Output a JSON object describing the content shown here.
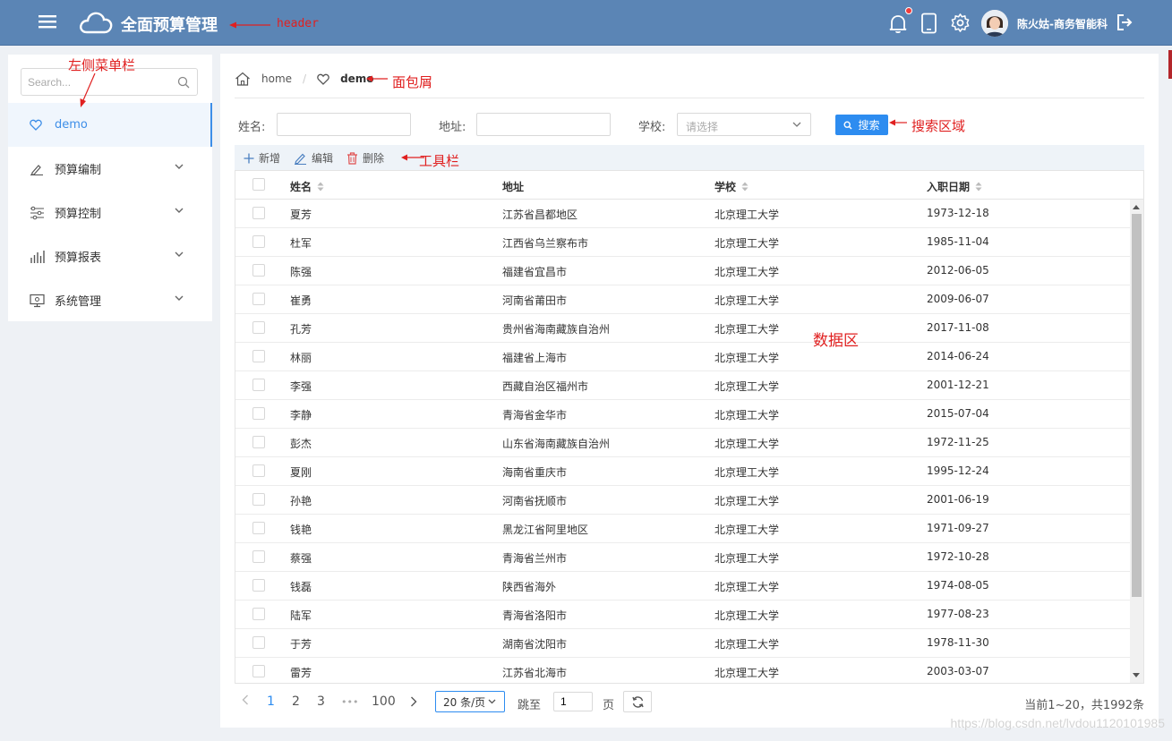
{
  "header": {
    "title": "全面预算管理",
    "user_name": "陈火姑-商务智能科",
    "icons": [
      "menu-icon",
      "cloud-icon",
      "bell-icon",
      "tablet-icon",
      "gear-icon",
      "logout-icon"
    ],
    "has_notification_dot": true
  },
  "annotations": {
    "header": "header",
    "sidebar": "左侧菜单栏",
    "breadcrumb": "面包屑",
    "search_area": "搜索区域",
    "toolbar": "工具栏",
    "data_area": "数据区"
  },
  "sidebar": {
    "search_placeholder": "Search...",
    "items": [
      {
        "label": "demo",
        "icon": "heart-icon",
        "active": true
      },
      {
        "label": "预算编制",
        "icon": "edit-icon"
      },
      {
        "label": "预算控制",
        "icon": "sliders-icon"
      },
      {
        "label": "预算报表",
        "icon": "bar-chart-icon"
      },
      {
        "label": "系统管理",
        "icon": "monitor-icon"
      }
    ]
  },
  "breadcrumb": {
    "home": "home",
    "current": "demo"
  },
  "search_form": {
    "name_label": "姓名:",
    "name_value": "",
    "address_label": "地址:",
    "address_value": "",
    "school_label": "学校:",
    "school_placeholder": "请选择",
    "search_button": "搜索"
  },
  "toolbar": {
    "add": "新增",
    "edit": "编辑",
    "delete": "删除"
  },
  "table": {
    "columns": [
      "姓名",
      "地址",
      "学校",
      "入职日期"
    ],
    "rows": [
      [
        "夏芳",
        "江苏省昌都地区",
        "北京理工大学",
        "1973-12-18"
      ],
      [
        "杜军",
        "江西省乌兰察布市",
        "北京理工大学",
        "1985-11-04"
      ],
      [
        "陈强",
        "福建省宜昌市",
        "北京理工大学",
        "2012-06-05"
      ],
      [
        "崔勇",
        "河南省莆田市",
        "北京理工大学",
        "2009-06-07"
      ],
      [
        "孔芳",
        "贵州省海南藏族自治州",
        "北京理工大学",
        "2017-11-08"
      ],
      [
        "林丽",
        "福建省上海市",
        "北京理工大学",
        "2014-06-24"
      ],
      [
        "李强",
        "西藏自治区福州市",
        "北京理工大学",
        "2001-12-21"
      ],
      [
        "李静",
        "青海省金华市",
        "北京理工大学",
        "2015-07-04"
      ],
      [
        "彭杰",
        "山东省海南藏族自治州",
        "北京理工大学",
        "1972-11-25"
      ],
      [
        "夏刚",
        "海南省重庆市",
        "北京理工大学",
        "1995-12-24"
      ],
      [
        "孙艳",
        "河南省抚顺市",
        "北京理工大学",
        "2001-06-19"
      ],
      [
        "钱艳",
        "黑龙江省阿里地区",
        "北京理工大学",
        "1971-09-27"
      ],
      [
        "蔡强",
        "青海省兰州市",
        "北京理工大学",
        "1972-10-28"
      ],
      [
        "钱磊",
        "陕西省海外",
        "北京理工大学",
        "1974-08-05"
      ],
      [
        "陆军",
        "青海省洛阳市",
        "北京理工大学",
        "1977-08-23"
      ],
      [
        "于芳",
        "湖南省沈阳市",
        "北京理工大学",
        "1978-11-30"
      ],
      [
        "雷芳",
        "江苏省北海市",
        "北京理工大学",
        "2003-03-07"
      ]
    ]
  },
  "pagination": {
    "pages": [
      "1",
      "2",
      "3",
      "•••",
      "100"
    ],
    "current": "1",
    "page_size": "20 条/页",
    "jump_label": "跳至",
    "jump_value": "1",
    "page_unit": "页",
    "total_text": "当前1~20，共1992条"
  },
  "watermark": "https://blog.csdn.net/lvdou1120101985",
  "colors": {
    "header_bg": "#5b85b5",
    "accent": "#2d8cf0",
    "annotation": "#e02020",
    "delete": "#e05050"
  }
}
